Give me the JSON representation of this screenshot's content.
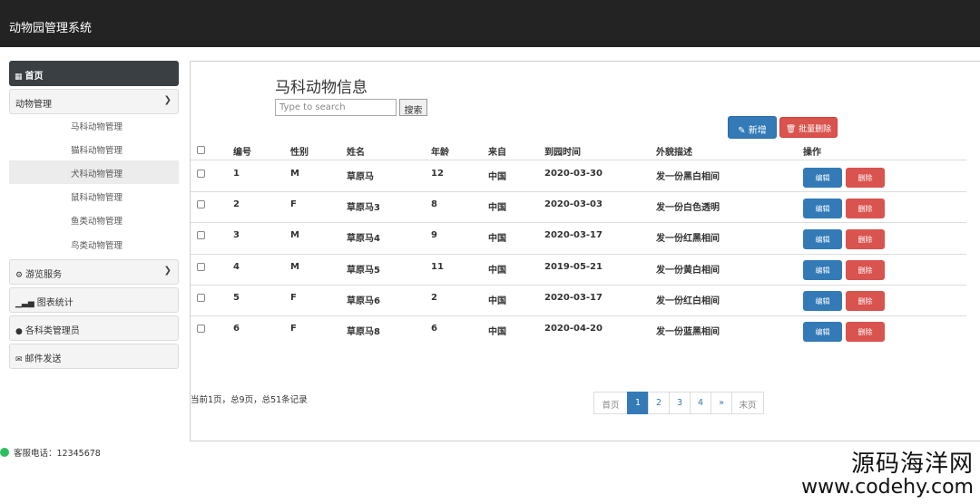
{
  "app": {
    "title": "动物园管理系统"
  },
  "sidebar": {
    "home": "首页",
    "animal_mgmt": "动物管理",
    "sub_items": [
      "马科动物管理",
      "猫科动物管理",
      "犬科动物管理",
      "鼠科动物管理",
      "鱼类动物管理",
      "鸟类动物管理"
    ],
    "tourist_service": "游览服务",
    "chart_stats": "图表统计",
    "keeper_mgmt": "各科类管理员",
    "email_send": "邮件发送"
  },
  "main": {
    "heading": "马科动物信息",
    "search": {
      "placeholder": "Type to search",
      "button": "搜索"
    },
    "add_button": "新增",
    "bulk_delete_button": "批量删除",
    "columns": [
      "编号",
      "性别",
      "姓名",
      "年龄",
      "来自",
      "到园时间",
      "外貌描述",
      "操作"
    ],
    "rows": [
      {
        "id": "1",
        "sex": "M",
        "name": "草原马",
        "age": "12",
        "from": "中国",
        "date": "2020-03-30",
        "desc": "发一份黑白相间"
      },
      {
        "id": "2",
        "sex": "F",
        "name": "草原马3",
        "age": "8",
        "from": "中国",
        "date": "2020-03-03",
        "desc": "发一份白色透明"
      },
      {
        "id": "3",
        "sex": "M",
        "name": "草原马4",
        "age": "9",
        "from": "中国",
        "date": "2020-03-17",
        "desc": "发一份红黑相间"
      },
      {
        "id": "4",
        "sex": "M",
        "name": "草原马5",
        "age": "11",
        "from": "中国",
        "date": "2019-05-21",
        "desc": "发一份黄白相间"
      },
      {
        "id": "5",
        "sex": "F",
        "name": "草原马6",
        "age": "2",
        "from": "中国",
        "date": "2020-03-17",
        "desc": "发一份红白相间"
      },
      {
        "id": "6",
        "sex": "F",
        "name": "草原马8",
        "age": "6",
        "from": "中国",
        "date": "2020-04-20",
        "desc": "发一份蓝黑相间"
      }
    ],
    "edit_label": "编辑",
    "delete_label": "删除",
    "page_info": "当前1页，总9页，总51条记录",
    "pagination": [
      "首页",
      "1",
      "2",
      "3",
      "4",
      "»",
      "末页"
    ]
  },
  "footer": {
    "service_phone": "客服电话：12345678"
  },
  "watermark": {
    "line1": "源码海洋网",
    "line2": "www.codehy.com"
  },
  "colors": {
    "topbar": "#232323",
    "primary": "#337ab7",
    "danger": "#d9534f"
  }
}
